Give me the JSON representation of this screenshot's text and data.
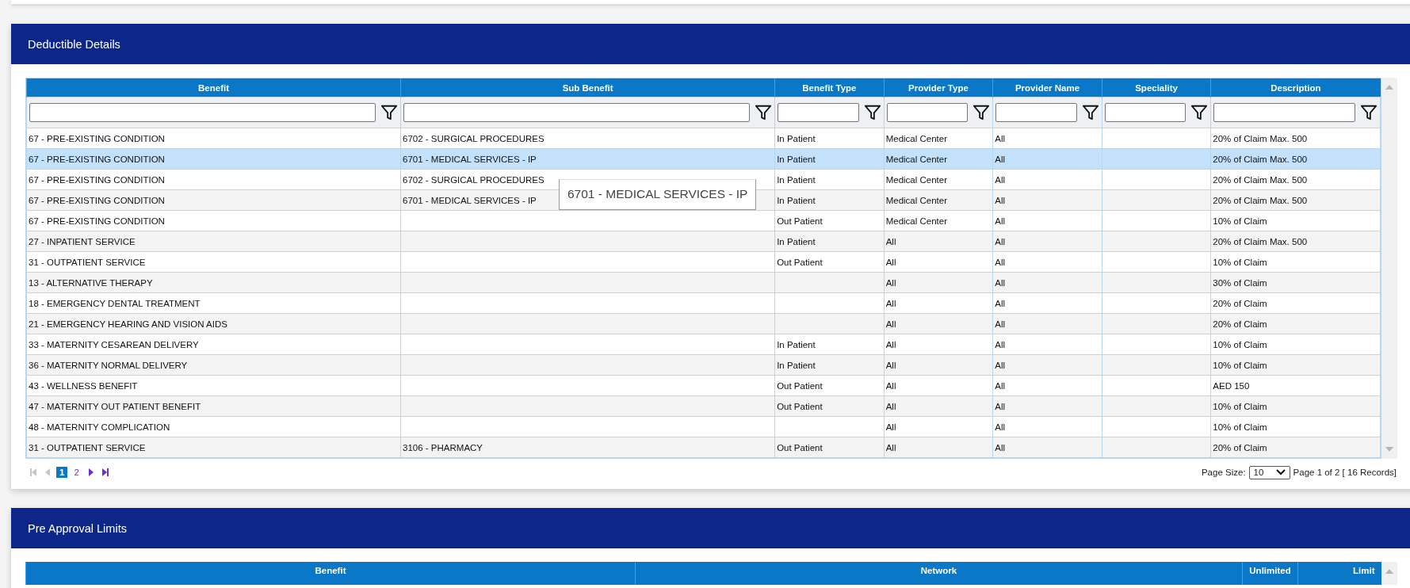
{
  "deductible_details": {
    "title": "Deductible Details",
    "table": {
      "columns": [
        "Benefit",
        "Sub Benefit",
        "Benefit Type",
        "Provider Type",
        "Provider Name",
        "Speciality",
        "Description"
      ],
      "rows": [
        {
          "cells": [
            "67 - PRE-EXISTING CONDITION",
            "6702 - SURGICAL PROCEDURES",
            "In Patient",
            "Medical Center",
            "All",
            "",
            "20% of Claim Max. 500"
          ],
          "selected": false
        },
        {
          "cells": [
            "67 - PRE-EXISTING CONDITION",
            "6701 - MEDICAL SERVICES - IP",
            "In Patient",
            "Medical Center",
            "All",
            "",
            "20% of Claim Max. 500"
          ],
          "selected": true
        },
        {
          "cells": [
            "67 - PRE-EXISTING CONDITION",
            "6702 - SURGICAL PROCEDURES",
            "In Patient",
            "Medical Center",
            "All",
            "",
            "20% of Claim Max. 500"
          ],
          "selected": false
        },
        {
          "cells": [
            "67 - PRE-EXISTING CONDITION",
            "6701 - MEDICAL SERVICES - IP",
            "In Patient",
            "Medical Center",
            "All",
            "",
            "20% of Claim Max. 500"
          ],
          "selected": false
        },
        {
          "cells": [
            "67 - PRE-EXISTING CONDITION",
            "",
            "Out Patient",
            "Medical Center",
            "All",
            "",
            "10% of Claim"
          ],
          "selected": false
        },
        {
          "cells": [
            "27 - INPATIENT SERVICE",
            "",
            "In Patient",
            "All",
            "All",
            "",
            "20% of Claim Max. 500"
          ],
          "selected": false
        },
        {
          "cells": [
            "31 - OUTPATIENT SERVICE",
            "",
            "Out Patient",
            "All",
            "All",
            "",
            "10% of Claim"
          ],
          "selected": false
        },
        {
          "cells": [
            "13 - ALTERNATIVE THERAPY",
            "",
            "",
            "All",
            "All",
            "",
            "30% of Claim"
          ],
          "selected": false
        },
        {
          "cells": [
            "18 - EMERGENCY DENTAL TREATMENT",
            "",
            "",
            "All",
            "All",
            "",
            "20% of Claim"
          ],
          "selected": false
        },
        {
          "cells": [
            "21 - EMERGENCY HEARING AND VISION AIDS",
            "",
            "",
            "All",
            "All",
            "",
            "20% of Claim"
          ],
          "selected": false
        },
        {
          "cells": [
            "33 - MATERNITY CESAREAN DELIVERY",
            "",
            "In Patient",
            "All",
            "All",
            "",
            "10% of Claim"
          ],
          "selected": false
        },
        {
          "cells": [
            "36 - MATERNITY NORMAL DELIVERY",
            "",
            "In Patient",
            "All",
            "All",
            "",
            "10% of Claim"
          ],
          "selected": false
        },
        {
          "cells": [
            "43 - WELLNESS BENEFIT",
            "",
            "Out Patient",
            "All",
            "All",
            "",
            "AED 150"
          ],
          "selected": false
        },
        {
          "cells": [
            "47 - MATERNITY OUT PATIENT BENEFIT",
            "",
            "Out Patient",
            "All",
            "All",
            "",
            "10% of Claim"
          ],
          "selected": false
        },
        {
          "cells": [
            "48 - MATERNITY COMPLICATION",
            "",
            "",
            "All",
            "All",
            "",
            "10% of Claim"
          ],
          "selected": false
        },
        {
          "cells": [
            "31 - OUTPATIENT SERVICE",
            "3106 - PHARMACY",
            "Out Patient",
            "All",
            "All",
            "",
            "20% of Claim"
          ],
          "selected": false
        }
      ]
    },
    "tooltip": "6701 - MEDICAL SERVICES - IP",
    "pager": {
      "nav": [
        {
          "kind": "first",
          "disabled": true
        },
        {
          "kind": "prev",
          "disabled": true
        }
      ],
      "pages": [
        {
          "label": "1",
          "selected": true
        },
        {
          "label": "2",
          "selected": false
        }
      ],
      "nav_end": [
        {
          "kind": "next",
          "disabled": false
        },
        {
          "kind": "last",
          "disabled": false
        }
      ],
      "page_size_label": "Page Size:",
      "page_size": "10",
      "summary": "Page 1 of 2 [ 16 Records]"
    }
  },
  "pre_approval_limits": {
    "title": "Pre Approval Limits",
    "columns": [
      "Benefit",
      "Network",
      "Unlimited",
      "Limit"
    ]
  }
}
